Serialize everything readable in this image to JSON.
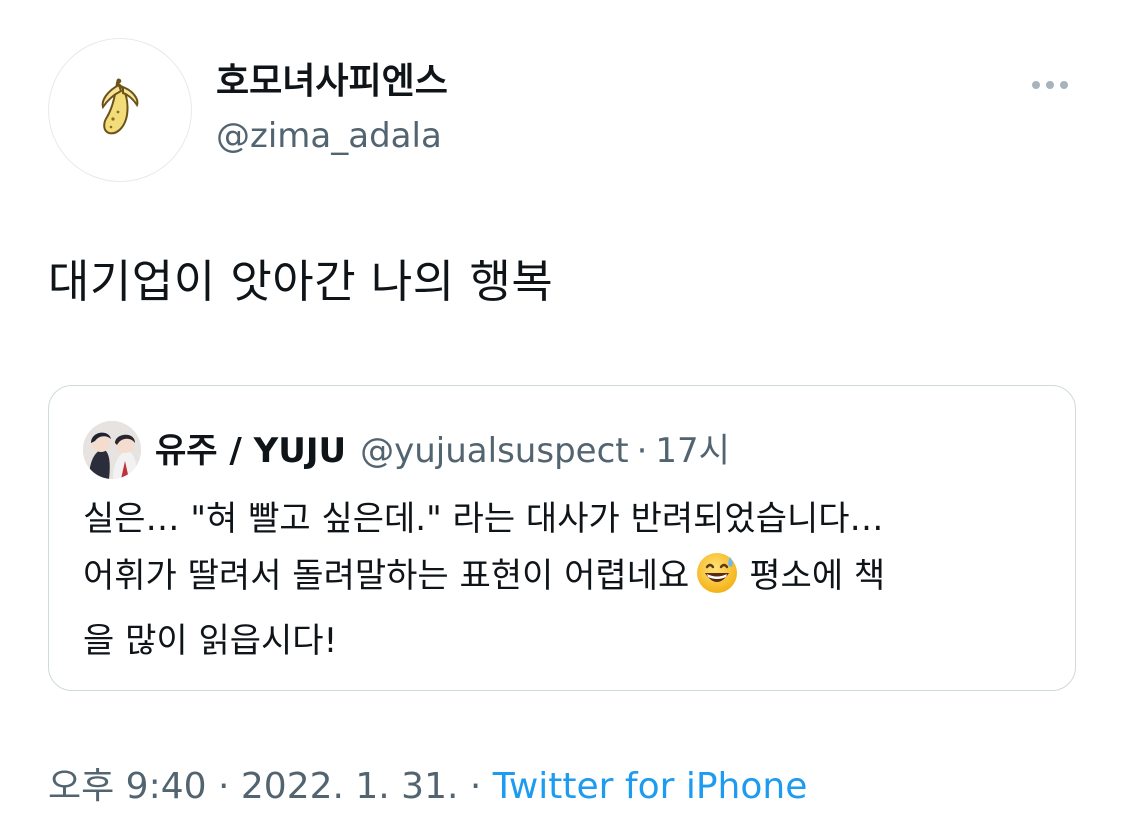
{
  "author": {
    "display_name": "호모녀사피엔스",
    "handle": "@zima_adala",
    "avatar_icon": "banana-icon"
  },
  "tweet": {
    "text": "대기업이 앗아간 나의 행복"
  },
  "quoted_tweet": {
    "display_name": "유주 / YUJU",
    "handle": "@yujualsuspect",
    "separator": "·",
    "time": "17시",
    "lines": [
      "실은… \"혀 빨고 싶은데.\" 라는 대사가 반려되었습니다…",
      "어휘가 딸려서 돌려말하는 표현이 어렵네요",
      "평소에 책",
      "을 많이 읽읍시다!"
    ],
    "emoji_icon": "grinning-face-with-sweat-icon"
  },
  "footer": {
    "time": "오후 9:40",
    "separator": "·",
    "date": "2022. 1. 31.",
    "separator2": "·",
    "source": "Twitter for iPhone"
  },
  "colors": {
    "text": "#0f1419",
    "secondary": "#536471",
    "link": "#1d9bf0",
    "border": "#cfd9de"
  },
  "icons": {
    "more": "more-horizontal-icon"
  }
}
